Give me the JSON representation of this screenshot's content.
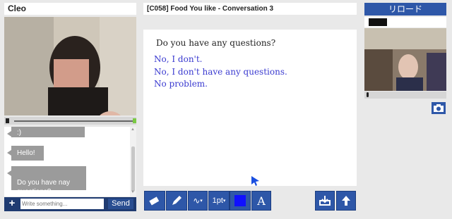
{
  "left": {
    "user_name": "Cleo",
    "chat": {
      "messages": [
        ":)",
        "Hello!",
        "Do you have nay\nquestions?"
      ],
      "input_placeholder": "Write something...",
      "send_label": "Send",
      "add_label": "+"
    },
    "volume_level_percent": 98
  },
  "center": {
    "lesson_title": "[C058] Food You like - Conversation 3",
    "question": "Do you have any questions?",
    "answers": [
      "No, I don't.",
      "No, I don't have any questions.",
      "No problem."
    ],
    "toolbar": {
      "line_width_label": "1pt",
      "text_tool_label": "A",
      "color": "#1010ff"
    }
  },
  "right": {
    "reload_label": "リロード"
  },
  "colors": {
    "toolbar_bg": "#2e57a8",
    "bubble_bg": "#9b9b9b",
    "answer_text": "#3a3ad0"
  }
}
